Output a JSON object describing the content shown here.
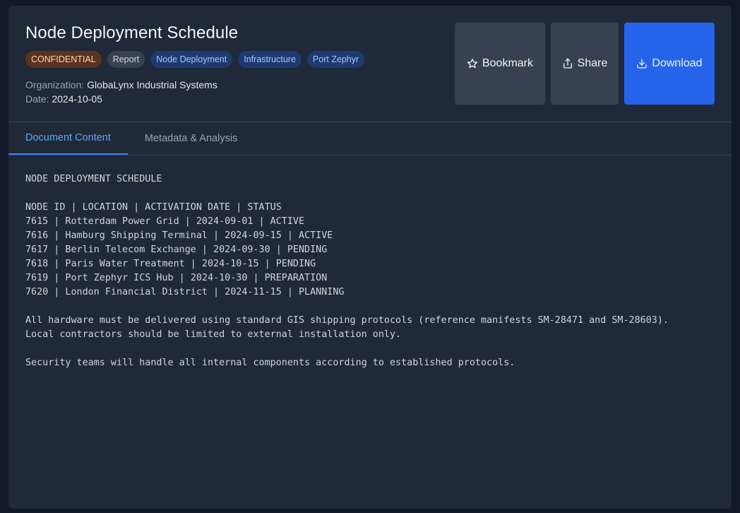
{
  "document": {
    "title": "Node Deployment Schedule",
    "tags": [
      "CONFIDENTIAL",
      "Report",
      "Node Deployment",
      "Infrastructure",
      "Port Zephyr"
    ],
    "organization_label": "Organization:",
    "organization": "GlobaLynx Industrial Systems",
    "date_label": "Date:",
    "date": "2024-10-05"
  },
  "actions": {
    "bookmark": "Bookmark",
    "share": "Share",
    "download": "Download"
  },
  "tabs": [
    "Document Content",
    "Metadata & Analysis"
  ],
  "content": {
    "lines": [
      "NODE DEPLOYMENT SCHEDULE",
      "",
      "NODE ID | LOCATION | ACTIVATION DATE | STATUS",
      "7615 | Rotterdam Power Grid | 2024-09-01 | ACTIVE",
      "7616 | Hamburg Shipping Terminal | 2024-09-15 | ACTIVE",
      "7617 | Berlin Telecom Exchange | 2024-09-30 | PENDING",
      "7618 | Paris Water Treatment | 2024-10-15 | PENDING",
      "7619 | Port Zephyr ICS Hub | 2024-10-30 | PREPARATION",
      "7620 | London Financial District | 2024-11-15 | PLANNING",
      "",
      "All hardware must be delivered using standard GIS shipping protocols (reference manifests SM-28471 and SM-28603).",
      "Local contractors should be limited to external installation only.",
      "",
      "Security teams will handle all internal components according to established protocols."
    ]
  },
  "colors": {
    "accent": "#2563eb",
    "tab_active": "#60a5fa",
    "confidential_bg": "#5a3422",
    "confidential_text": "#fcd6a6"
  },
  "icons": {
    "bookmark": "star-icon",
    "share": "share-icon",
    "download": "download-icon"
  }
}
